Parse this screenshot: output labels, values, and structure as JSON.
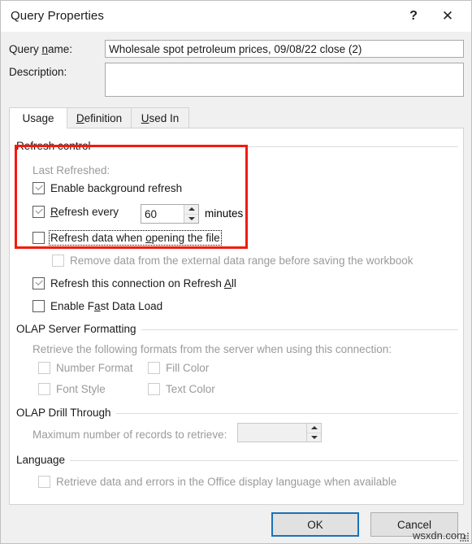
{
  "window": {
    "title": "Query Properties",
    "help_icon": "question-mark-icon",
    "help_glyph": "?",
    "close_icon": "close-icon",
    "close_glyph": "✕"
  },
  "fields": {
    "query_name_label": "Query name:",
    "query_name_accel": "n",
    "query_name_value": "Wholesale spot petroleum prices, 09/08/22 close (2)",
    "query_name_placeholder": "",
    "description_label": "Description:",
    "description_value": "",
    "description_placeholder": ""
  },
  "tabs": [
    {
      "label": "Usage",
      "accel": "g",
      "active": true
    },
    {
      "label": "Definition",
      "accel": "D",
      "active": false
    },
    {
      "label": "Used In",
      "accel": "U",
      "active": false
    }
  ],
  "refresh_control": {
    "group_label": "Refresh control",
    "last_refreshed_label": "Last Refreshed:",
    "enable_background_refresh": {
      "label": "Enable background refresh",
      "accel": "g",
      "checked": true,
      "enabled": true
    },
    "refresh_every": {
      "label": "Refresh every",
      "accel": "R",
      "checked": true,
      "enabled": true,
      "value": "60",
      "units_label": "minutes"
    },
    "refresh_on_open": {
      "label": "Refresh data when opening the file",
      "accel": "o",
      "checked": false,
      "enabled": true,
      "focused": true
    },
    "remove_data_before_save": {
      "label": "Remove data from the external data range before saving the workbook",
      "checked": false,
      "enabled": false
    },
    "refresh_on_refresh_all": {
      "label": "Refresh this connection on Refresh All",
      "accel": "A",
      "checked": true,
      "enabled": true
    },
    "enable_fast_data_load": {
      "label": "Enable Fast Data Load",
      "accel": "a",
      "checked": false,
      "enabled": true
    }
  },
  "olap_server_formatting": {
    "group_label": "OLAP Server Formatting",
    "description": "Retrieve the following formats from the server when using this connection:",
    "options": [
      {
        "label": "Number Format",
        "checked": false,
        "enabled": false
      },
      {
        "label": "Fill Color",
        "checked": false,
        "enabled": false
      },
      {
        "label": "Font Style",
        "checked": false,
        "enabled": false
      },
      {
        "label": "Text Color",
        "checked": false,
        "enabled": false
      }
    ]
  },
  "olap_drill_through": {
    "group_label": "OLAP Drill Through",
    "max_records_label": "Maximum number of records to retrieve:",
    "max_records_value": "",
    "max_records_placeholder": "",
    "enabled": false
  },
  "language": {
    "group_label": "Language",
    "retrieve_label": "Retrieve data and errors in the Office display language when available",
    "checked": false,
    "enabled": false
  },
  "footer": {
    "ok_label": "OK",
    "cancel_label": "Cancel"
  },
  "overlay": {
    "annotation_color": "#f21b0d",
    "watermark": "wsxdn.com"
  }
}
